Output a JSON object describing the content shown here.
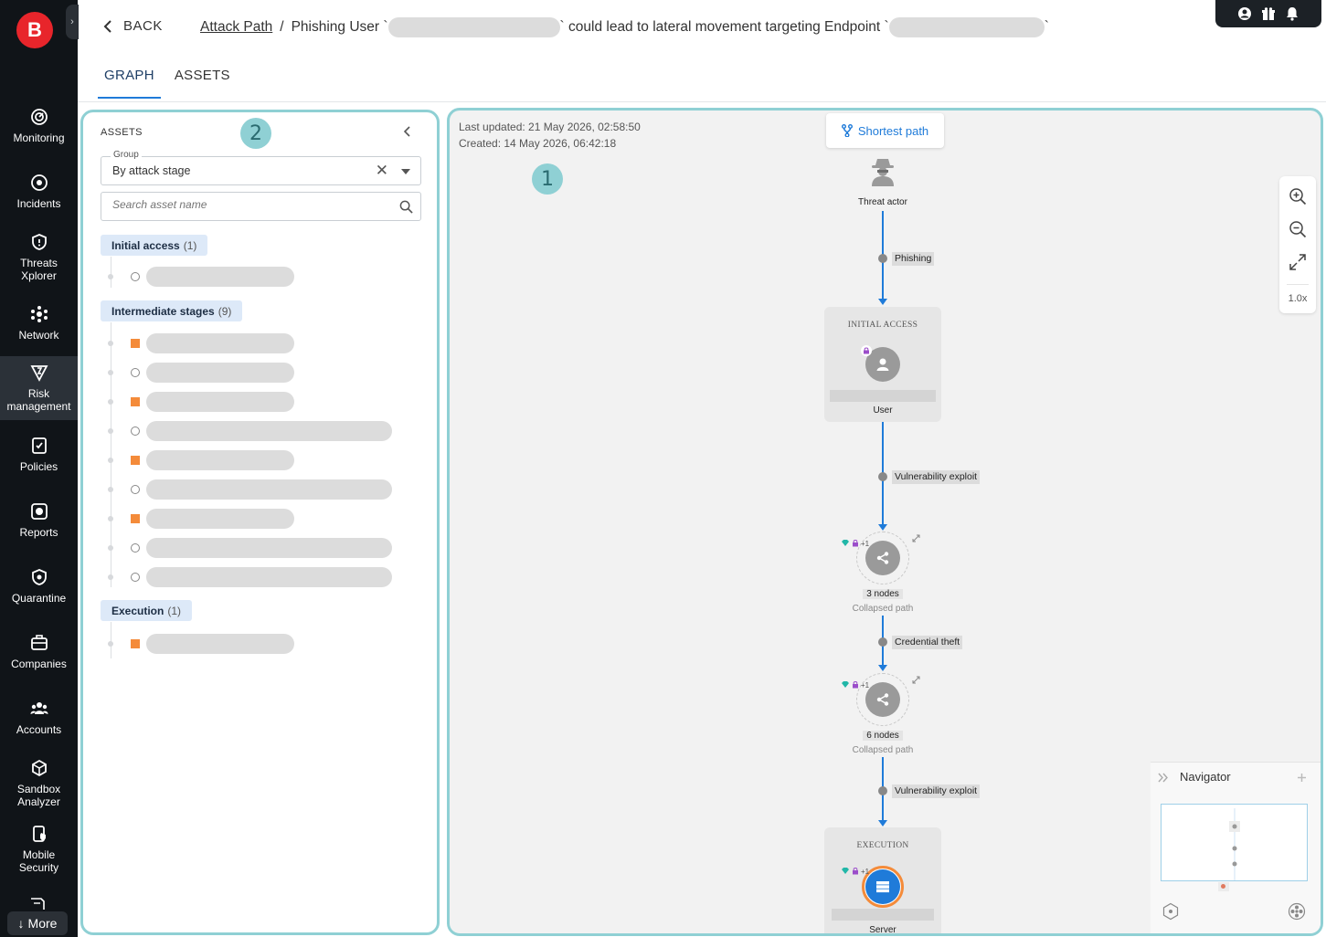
{
  "sidebar": {
    "logo": "B",
    "items": [
      {
        "label": "Monitoring",
        "icon": "monitoring-icon"
      },
      {
        "label": "Incidents",
        "icon": "incidents-icon"
      },
      {
        "label": "Threats Xplorer",
        "icon": "shield-icon"
      },
      {
        "label": "Network",
        "icon": "network-icon"
      },
      {
        "label": "Risk management",
        "icon": "risk-icon",
        "active": true
      },
      {
        "label": "Policies",
        "icon": "policies-icon"
      },
      {
        "label": "Reports",
        "icon": "reports-icon"
      },
      {
        "label": "Quarantine",
        "icon": "quarantine-icon"
      },
      {
        "label": "Companies",
        "icon": "companies-icon"
      },
      {
        "label": "Accounts",
        "icon": "accounts-icon"
      },
      {
        "label": "Sandbox Analyzer",
        "icon": "sandbox-icon"
      },
      {
        "label": "Mobile Security",
        "icon": "mobile-security-icon"
      }
    ],
    "more_label": "More"
  },
  "header": {
    "back_label": "BACK",
    "breadcrumb_link": "Attack Path",
    "breadcrumb_sep": "/",
    "title_part1": "Phishing User `",
    "title_part2": "` could lead to lateral movement targeting Endpoint `",
    "title_part3": "`",
    "tabs": [
      {
        "label": "GRAPH",
        "active": true
      },
      {
        "label": "ASSETS",
        "active": false
      }
    ]
  },
  "assets_panel": {
    "title": "ASSETS",
    "callout": "2",
    "group_label": "Group",
    "group_value": "By attack stage",
    "search_placeholder": "Search asset name",
    "stages": [
      {
        "name": "Initial access",
        "count": "(1)"
      },
      {
        "name": "Intermediate stages",
        "count": "(9)"
      },
      {
        "name": "Execution",
        "count": "(1)"
      }
    ]
  },
  "graph": {
    "callout": "1",
    "last_updated": "Last updated: 21 May 2026, 02:58:50",
    "created": "Created: 14 May 2026, 06:42:18",
    "shortest_path": "Shortest path",
    "zoom_level": "1.0x",
    "threat_actor": "Threat actor",
    "edges": [
      "Phishing",
      "Vulnerability exploit",
      "Credential theft",
      "Vulnerability exploit"
    ],
    "initial_access_title": "INITIAL ACCESS",
    "user_label": "User",
    "collapsed1_nodes": "3 nodes",
    "collapsed1_sub": "Collapsed path",
    "collapsed2_nodes": "6 nodes",
    "collapsed2_sub": "Collapsed path",
    "execution_title": "EXECUTION",
    "server_label": "Server",
    "plus_badge": "+1",
    "navigator_title": "Navigator"
  },
  "colors": {
    "accent": "#1f7bd9",
    "callout": "#8fd0d4",
    "asset_square": "#f48b3a",
    "logo": "#e8252b"
  }
}
